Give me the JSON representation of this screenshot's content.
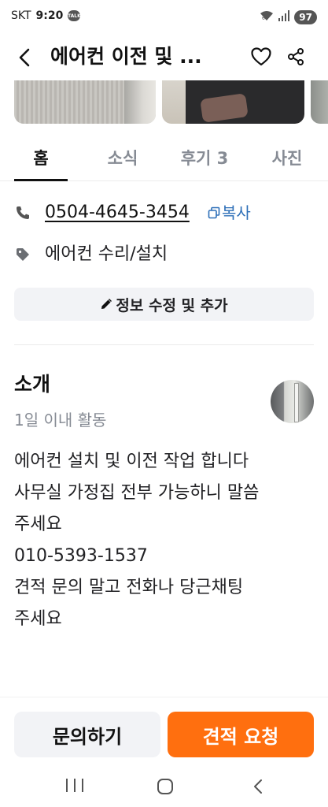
{
  "status_bar": {
    "carrier": "SKT",
    "time": "9:20",
    "talk_badge": "TALK",
    "battery": "97"
  },
  "header": {
    "title": "에어컨 이전 및 ...",
    "icons": [
      "chevron-left-icon",
      "heart-icon",
      "share-icon"
    ]
  },
  "tabs": [
    {
      "label": "홈",
      "active": true
    },
    {
      "label": "소식",
      "active": false
    },
    {
      "label": "후기 3",
      "active": false
    },
    {
      "label": "사진",
      "active": false
    }
  ],
  "info": {
    "phone": "0504-4645-3454",
    "copy_label": "복사",
    "category": "에어컨 수리/설치",
    "edit_label": "정보 수정 및 추가"
  },
  "intro": {
    "title": "소개",
    "activity": "1일 이내 활동",
    "body_lines": [
      "에어컨 설치 및 이전 작업 합니다",
      "사무실 가정집 전부 가능하니 말씀",
      "주세요",
      "010-5393-1537",
      "견적 문의 말고 전화나 당근채팅",
      "주세요"
    ]
  },
  "actions": {
    "inquiry_label": "문의하기",
    "quote_label": "견적 요청"
  },
  "colors": {
    "accent": "#ff6f0f",
    "link": "#2d6fb8",
    "muted": "#868b94"
  }
}
